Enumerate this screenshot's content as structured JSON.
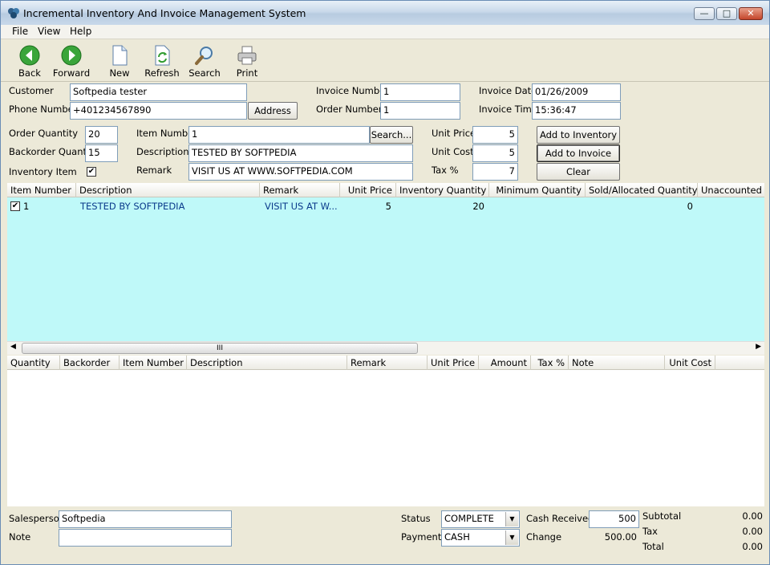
{
  "window": {
    "title": "Incremental Inventory And Invoice Management System"
  },
  "menu": [
    "File",
    "View",
    "Help"
  ],
  "toolbar": {
    "back": "Back",
    "forward": "Forward",
    "new": "New",
    "refresh": "Refresh",
    "search": "Search",
    "print": "Print"
  },
  "customer": {
    "customer_label": "Customer",
    "customer_value": "Softpedia tester",
    "phone_label": "Phone Number",
    "phone_value": "+401234567890",
    "address_button": "Address"
  },
  "invoice": {
    "invoice_number_label": "Invoice Number",
    "invoice_number_value": "1",
    "order_number_label": "Order Number",
    "order_number_value": "1",
    "invoice_date_label": "Invoice Date",
    "invoice_date_value": "01/26/2009",
    "invoice_time_label": "Invoice Time",
    "invoice_time_value": "15:36:47"
  },
  "item": {
    "order_qty_label": "Order Quantity",
    "order_qty_value": "20",
    "backorder_qty_label": "Backorder Quantity",
    "backorder_qty_value": "15",
    "inventory_item_label": "Inventory Item",
    "inventory_item_checked": "✔",
    "item_number_label": "Item Number",
    "item_number_value": "1",
    "search_button": "Search...",
    "description_label": "Description",
    "description_value": "TESTED BY SOFTPEDIA",
    "remark_label": "Remark",
    "remark_value": "VISIT US AT WWW.SOFTPEDIA.COM",
    "unit_price_label": "Unit Price",
    "unit_price_value": "5",
    "unit_cost_label": "Unit Cost",
    "unit_cost_value": "5",
    "tax_label": "Tax %",
    "tax_value": "7",
    "add_inventory_button": "Add to Inventory",
    "add_invoice_button": "Add to Invoice",
    "clear_button": "Clear"
  },
  "inventory_grid": {
    "columns": [
      "Item Number",
      "Description",
      "Remark",
      "Unit Price",
      "Inventory Quantity",
      "Minimum Quantity",
      "Sold/Allocated Quantity",
      "Unaccounted"
    ],
    "rows": [
      {
        "checked": "✔",
        "item_number": "1",
        "description": "TESTED BY SOFTPEDIA",
        "remark": "VISIT US AT W...",
        "unit_price": "5",
        "inventory_quantity": "20",
        "sold_allocated": "0"
      }
    ],
    "scroll_thumb": "III"
  },
  "invoice_grid": {
    "columns": [
      "Quantity",
      "Backorder",
      "Item Number",
      "Description",
      "Remark",
      "Unit Price",
      "Amount",
      "Tax %",
      "Note",
      "Unit Cost"
    ]
  },
  "footer": {
    "salesperson_label": "Salesperson",
    "salesperson_value": "Softpedia",
    "note_label": "Note",
    "note_value": "",
    "status_label": "Status",
    "status_value": "COMPLETE",
    "payment_label": "Payment",
    "payment_value": "CASH",
    "cash_received_label": "Cash Received",
    "cash_received_value": "500",
    "change_label": "Change",
    "change_value": "500.00",
    "subtotal_label": "Subtotal",
    "subtotal_value": "0.00",
    "tax_label": "Tax",
    "tax_value": "0.00",
    "total_label": "Total",
    "total_value": "0.00"
  },
  "colors": {
    "grid_background": "#bff9f9",
    "window_face": "#ece9d8",
    "title_gradient_top": "#e8f0f8"
  }
}
